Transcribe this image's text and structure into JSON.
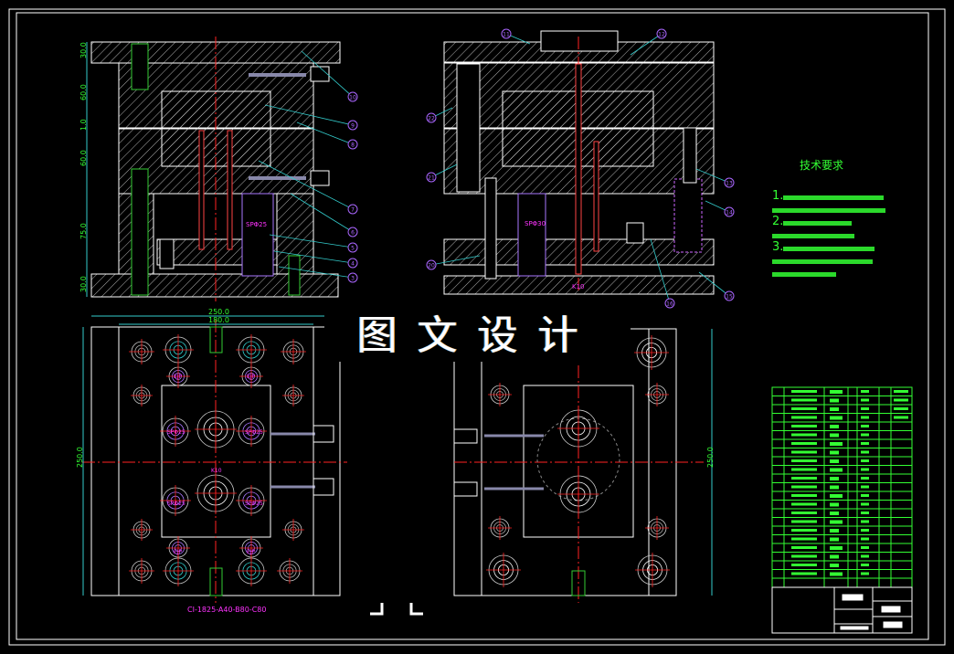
{
  "colors": {
    "background": "#000000",
    "outline": "#ffffff",
    "dimension": "#33ff33",
    "leader": "#33cccc",
    "balloon": "#cc66ff",
    "centerline": "#ff2222",
    "label": "#ff33ff",
    "table": "#33ff33"
  },
  "watermark": "图文设计",
  "left_section": {
    "dimensions": [
      "30.0",
      "60.0",
      "1.0",
      "60.0",
      "75.0",
      "30.0"
    ],
    "balloons": [
      "10",
      "9",
      "8",
      "7",
      "6",
      "5",
      "4",
      "3"
    ],
    "label": "SPΦ25"
  },
  "right_section": {
    "balloons": [
      "11",
      "12",
      "22",
      "21",
      "13",
      "14",
      "20",
      "15",
      "16"
    ],
    "labels": [
      "SPΦ30",
      "K10"
    ]
  },
  "left_plan": {
    "dimensions": {
      "width_outer": "250.0",
      "width_inner": "180.0",
      "height": "250.0"
    },
    "labels": [
      "EJP",
      "EJP",
      "SPΦ25",
      "SPΦ25",
      "SPΦ25",
      "SPΦ25",
      "K10",
      "EJP",
      "EJP"
    ],
    "mold_base_code": "CI-1825-A40-B80-C80"
  },
  "right_plan": {
    "dimensions": {
      "height": "250.0"
    }
  },
  "technical_requirements": {
    "title": "技术要求",
    "items": [
      "1.",
      "2.",
      "3."
    ]
  },
  "parts_table": {
    "rows": 22
  }
}
